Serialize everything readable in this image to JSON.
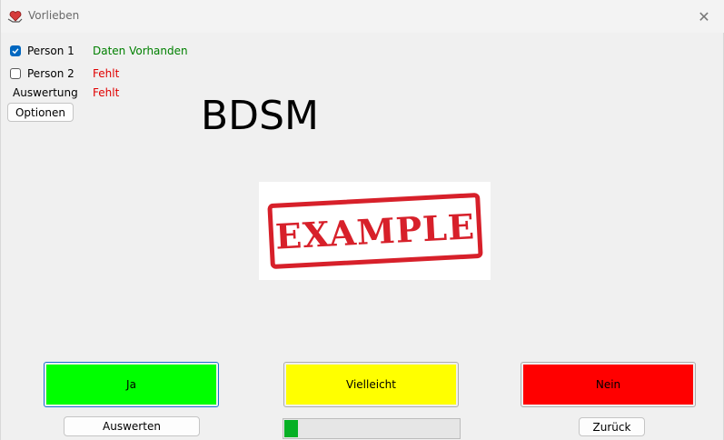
{
  "window": {
    "title": "Vorlieben",
    "close_glyph": "✕"
  },
  "persons": [
    {
      "label": "Person 1",
      "checked": true,
      "status": "Daten Vorhanden",
      "status_color": "#008000"
    },
    {
      "label": "Person 2",
      "checked": false,
      "status": "Fehlt",
      "status_color": "#e00000"
    }
  ],
  "evaluation": {
    "label": "Auswertung",
    "status": "Fehlt"
  },
  "options_button": "Optionen",
  "category_title": "BDSM",
  "example_image_text": "EXAMPLE",
  "answers": {
    "yes": {
      "label": "Ja",
      "color": "#00ff00"
    },
    "maybe": {
      "label": "Vielleicht",
      "color": "#ffff00"
    },
    "no": {
      "label": "Nein",
      "color": "#ff0000"
    }
  },
  "evaluate_button": "Auswerten",
  "back_button": "Zurück",
  "progress": {
    "fraction": 0.08,
    "color": "#06b025"
  }
}
